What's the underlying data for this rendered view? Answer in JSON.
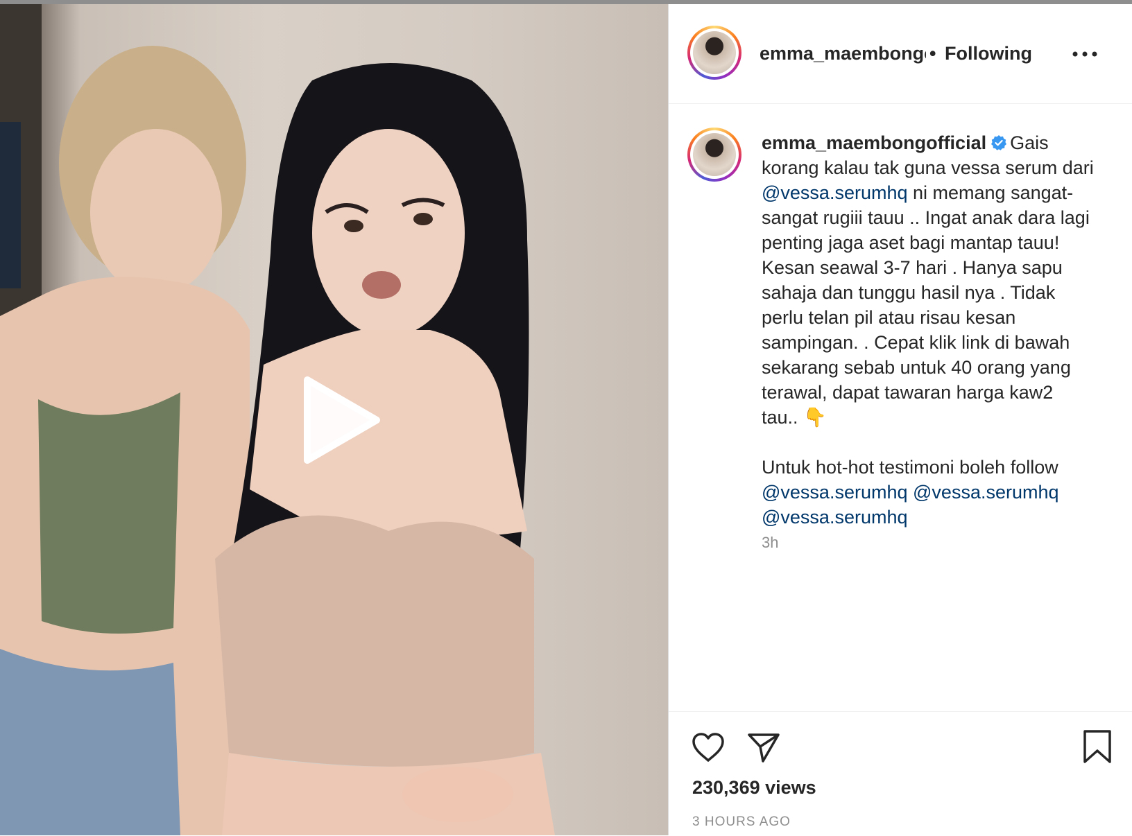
{
  "post": {
    "username_header": "emma_maembongofficial",
    "follow_status": "Following",
    "caption": {
      "username": "emma_maembongofficial",
      "text_1": "Gais korang kalau tak guna vessa serum dari ",
      "mention_1": "@vessa.serumhq",
      "text_2": " ni memang sangat-sangat rugiii tauu .. Ingat anak dara lagi penting jaga aset bagi mantap tauu! Kesan seawal 3-7 hari . Hanya sapu sahaja dan tunggu hasil nya . Tidak perlu telan pil atau risau kesan sampingan. . Cepat klik link di bawah sekarang sebab untuk 40 orang yang terawal, dapat tawaran harga kaw2 tau.. ",
      "emoji": "👇",
      "text_3": "Untuk hot-hot testimoni boleh follow",
      "mention_2": "@vessa.serumhq",
      "mention_3": "@vessa.serumhq",
      "mention_4": "@vessa.serumhq"
    },
    "caption_age": "3h",
    "views": "230,369 views",
    "posted_ago": "3 HOURS AGO"
  },
  "icons": {
    "play": "play-icon",
    "more": "more-options-icon",
    "like": "heart-icon",
    "share": "paper-plane-icon",
    "save": "bookmark-icon",
    "verified": "verified-badge-icon"
  },
  "colors": {
    "mention": "#00376b",
    "verified": "#3897f0",
    "text": "#262626",
    "muted": "#8e8e8e"
  }
}
